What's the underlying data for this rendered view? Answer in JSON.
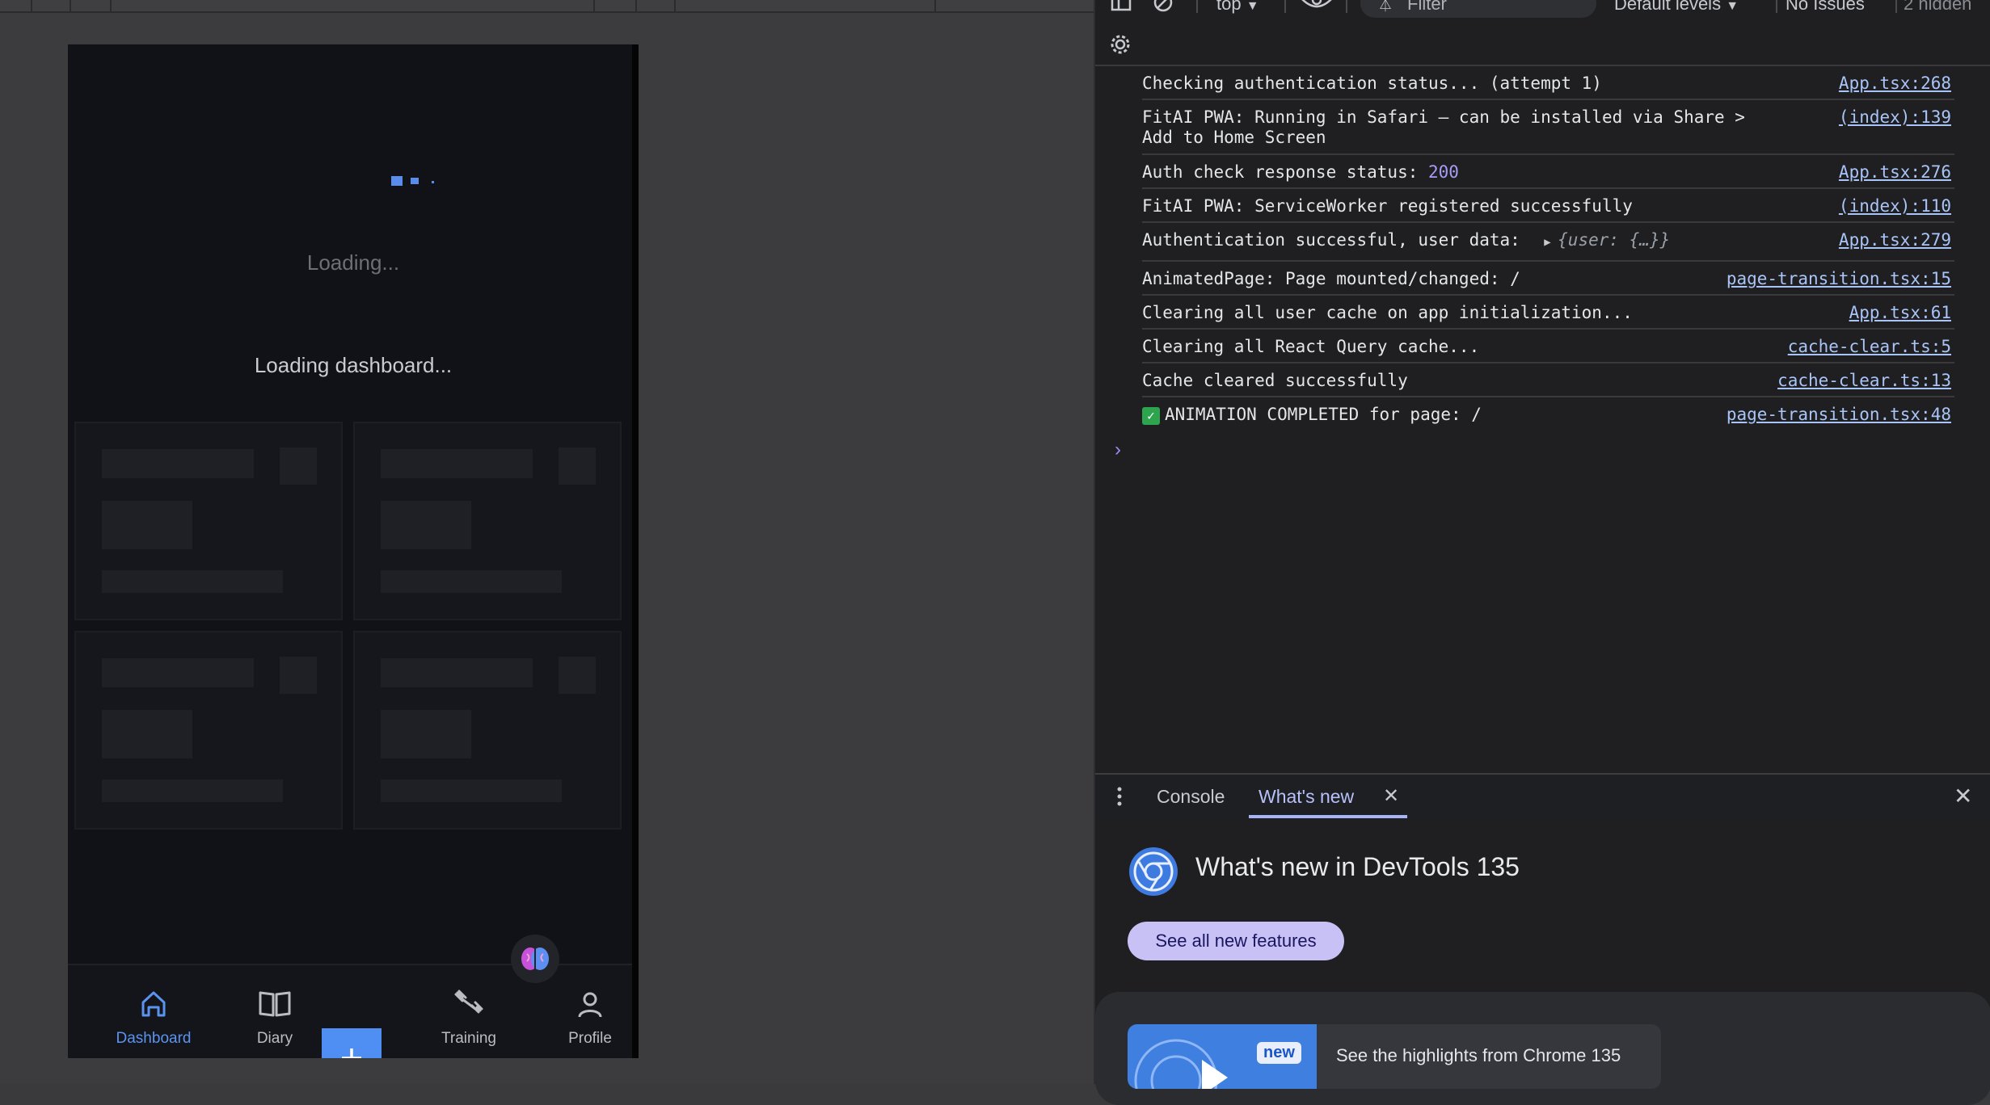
{
  "devtools_toolbar": {
    "context": "top",
    "filter_placeholder": "Filter",
    "levels": "Default levels",
    "issues": "No Issues",
    "hidden": "2 hidden"
  },
  "console": {
    "rows": [
      {
        "message": "Checking authentication status... (attempt 1)",
        "source": "App.tsx:268"
      },
      {
        "message": "FitAI PWA: Running in Safari – can be installed via Share >",
        "message2": "Add to Home Screen",
        "source": "(index):139"
      },
      {
        "message": "Auth check response status: ",
        "value": "200",
        "source": "App.tsx:276"
      },
      {
        "message": "FitAI PWA: ServiceWorker registered successfully",
        "source": "(index):110"
      },
      {
        "message": "Authentication successful, user data: ",
        "object": "{user: {…}}",
        "source": "App.tsx:279"
      },
      {
        "message": "AnimatedPage: Page mounted/changed: /",
        "source": "page-transition.tsx:15"
      },
      {
        "message": "Clearing all user cache on app initialization...",
        "source": "App.tsx:61"
      },
      {
        "message": "Clearing all React Query cache...",
        "source": "cache-clear.ts:5"
      },
      {
        "message": "Cache cleared successfully",
        "source": "cache-clear.ts:13"
      },
      {
        "message": "ANIMATION COMPLETED for page: /",
        "source": "page-transition.tsx:48"
      }
    ],
    "prompt": "›"
  },
  "drawer": {
    "tab_console": "Console",
    "tab_whatsnew": "What's new",
    "title": "What's new in DevTools 135",
    "button": "See all new features",
    "badge": "new",
    "highlight_text": "See the highlights from Chrome 135"
  },
  "app": {
    "loading_text": "Loading...",
    "loading_dashboard": "Loading dashboard...",
    "nav": {
      "dashboard": "Dashboard",
      "diary": "Diary",
      "training": "Training",
      "profile": "Profile"
    },
    "accent": "#4f8ef3"
  }
}
